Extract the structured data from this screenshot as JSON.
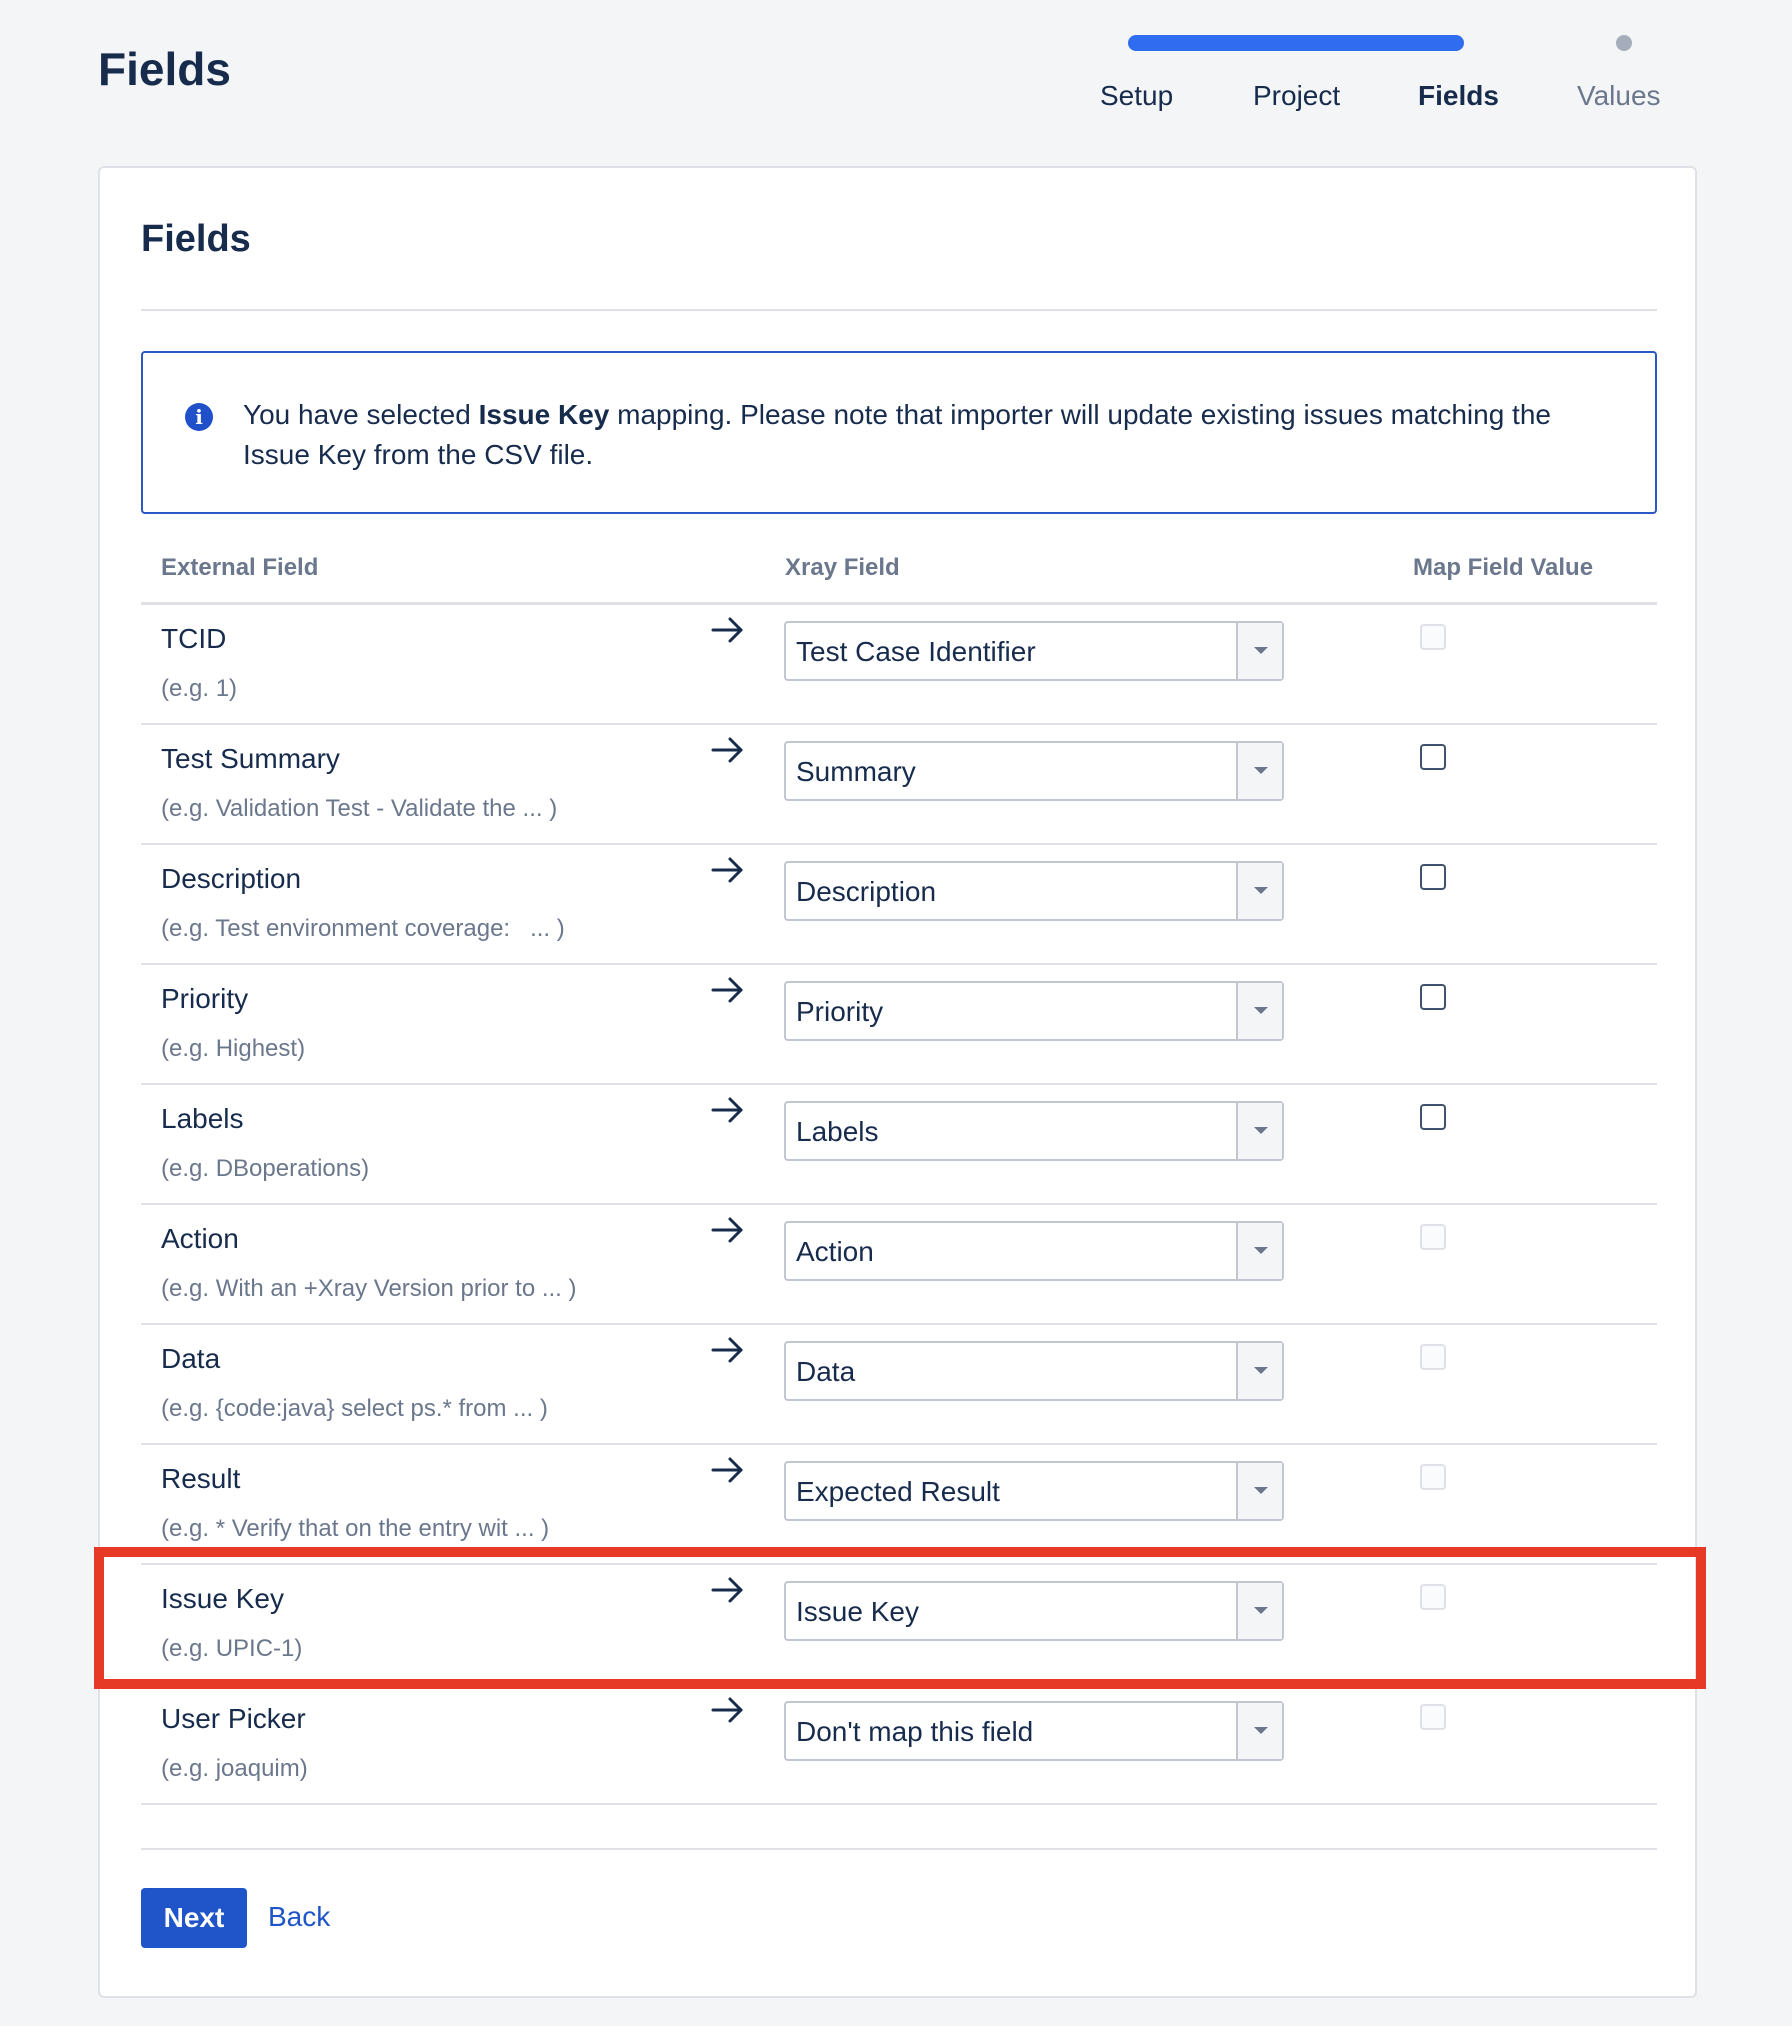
{
  "page": {
    "title": "Fields"
  },
  "progress": {
    "steps": [
      "Setup",
      "Project",
      "Fields",
      "Values"
    ],
    "current": "Fields"
  },
  "card": {
    "title": "Fields",
    "info": {
      "prefix": "You have selected ",
      "bold": "Issue Key",
      "suffix": " mapping. Please note that importer will update existing issues matching the Issue Key from the CSV file."
    },
    "headers": {
      "external": "External Field",
      "xray": "Xray Field",
      "map": "Map Field Value"
    },
    "rows": [
      {
        "name": "TCID",
        "example": "(e.g. 1)",
        "value": "Test Case Identifier",
        "checkbox": "disabled"
      },
      {
        "name": "Test Summary",
        "example": "(e.g. Validation Test - Validate the ... )",
        "value": "Summary",
        "checkbox": "enabled"
      },
      {
        "name": "Description",
        "example": "(e.g. Test environment coverage:   ... )",
        "value": "Description",
        "checkbox": "enabled"
      },
      {
        "name": "Priority",
        "example": "(e.g. Highest)",
        "value": "Priority",
        "checkbox": "enabled"
      },
      {
        "name": "Labels",
        "example": "(e.g. DBoperations)",
        "value": "Labels",
        "checkbox": "enabled"
      },
      {
        "name": "Action",
        "example": "(e.g. With an +Xray Version prior to ... )",
        "value": "Action",
        "checkbox": "disabled"
      },
      {
        "name": "Data",
        "example": "(e.g. {code:java} select ps.* from ... )",
        "value": "Data",
        "checkbox": "disabled"
      },
      {
        "name": "Result",
        "example": "(e.g. * Verify that on the entry wit ... )",
        "value": "Expected Result",
        "checkbox": "disabled"
      },
      {
        "name": "Issue Key",
        "example": "(e.g. UPIC-1)",
        "value": "Issue Key",
        "checkbox": "disabled"
      },
      {
        "name": "User Picker",
        "example": "(e.g. joaquim)",
        "value": "Don't map this field",
        "checkbox": "disabled"
      }
    ],
    "buttons": {
      "next": "Next",
      "back": "Back"
    }
  },
  "colors": {
    "accent": "#1f55c8",
    "progress": "#2f6cf0",
    "highlight": "#e63a26"
  }
}
